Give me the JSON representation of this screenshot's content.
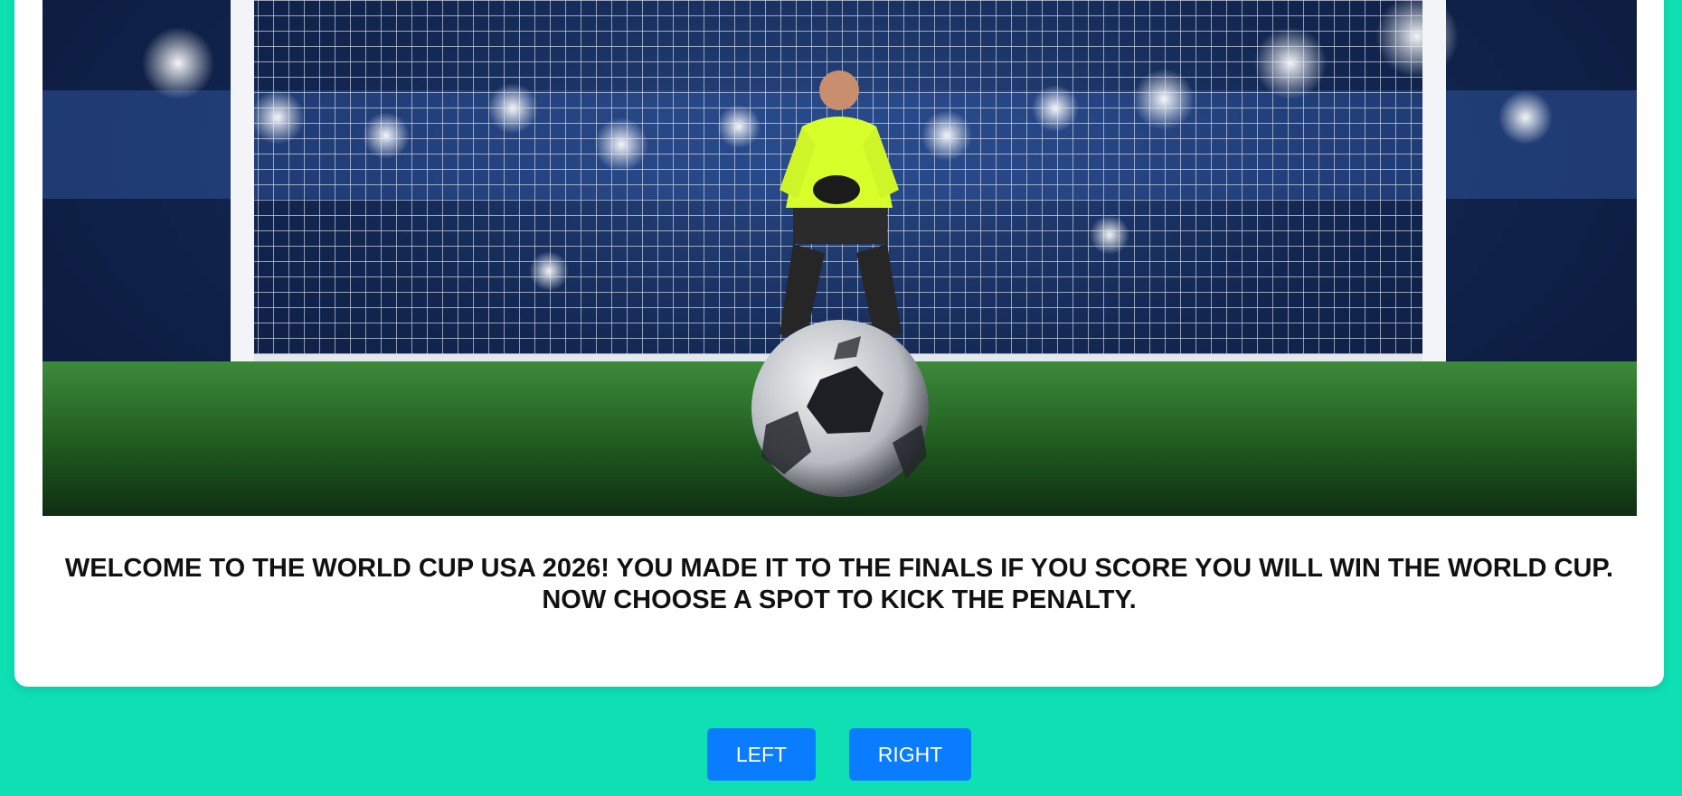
{
  "game": {
    "message": "WELCOME TO THE WORLD CUP USA 2026! YOU MADE IT TO THE FINALS IF YOU SCORE YOU WILL WIN THE WORLD CUP. NOW CHOOSE A SPOT TO KICK THE PENALTY.",
    "scene_icon": "penalty-kick-scene-icon"
  },
  "controls": {
    "left_label": "LEFT",
    "right_label": "RIGHT"
  },
  "colors": {
    "background": "#0ee0b4",
    "button": "#0a7cff",
    "card": "#ffffff"
  }
}
